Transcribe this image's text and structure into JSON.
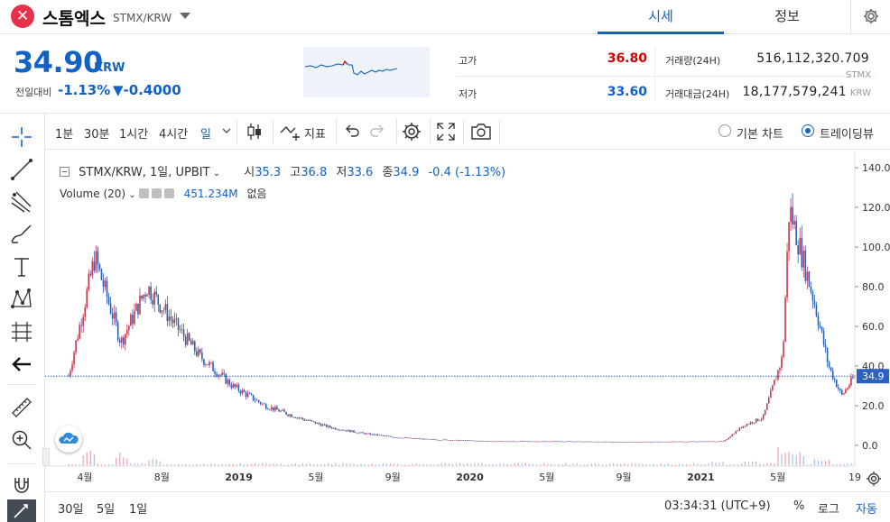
{
  "header": {
    "coin_name": "스톰엑스",
    "pair": "STMX/KRW",
    "tabs": [
      {
        "label": "시세",
        "active": true
      },
      {
        "label": "정보",
        "active": false
      }
    ]
  },
  "summary": {
    "price": "34.90",
    "price_unit": "KRW",
    "change_label": "전일대비",
    "change_rate": "-1.13%",
    "change_amount": "▼-0.4000",
    "high_label": "고가",
    "high_value": "36.80",
    "low_label": "저가",
    "low_value": "33.60",
    "volume_label": "거래량(24H)",
    "volume_value": "516,112,320.709",
    "volume_unit": "STMX",
    "amount_label": "거래대금(24H)",
    "amount_value": "18,177,579,241",
    "amount_unit": "KRW",
    "colors": {
      "up": "#d60000",
      "down": "#1261c4"
    }
  },
  "toolbar": {
    "intervals": [
      "1분",
      "30분",
      "1시간",
      "4시간",
      "일"
    ],
    "active_interval": "일",
    "indicators_label": "지표",
    "chart_types": [
      {
        "label": "기본 차트",
        "selected": false
      },
      {
        "label": "트레이딩뷰",
        "selected": true
      }
    ]
  },
  "chart": {
    "legend": {
      "symbol": "STMX/KRW, 1일, UPBIT",
      "open_key": "시",
      "open": "35.3",
      "high_key": "고",
      "high": "36.8",
      "low_key": "저",
      "low": "33.6",
      "close_key": "종",
      "close": "34.9",
      "change": "-0.4 (-1.13%)",
      "volume_label": "Volume (20)",
      "volume_value": "451.234M",
      "volume_extra": "없음"
    },
    "last_price_label": "34.9"
  },
  "chart_data": {
    "type": "line",
    "title": "",
    "xlabel": "",
    "ylabel": "",
    "x_ticks": [
      "4월",
      "8월",
      "2019",
      "5월",
      "9월",
      "2020",
      "5월",
      "9월",
      "2021",
      "5월",
      "19"
    ],
    "y_ticks": [
      "0.0",
      "20.0",
      "40.0",
      "60.0",
      "80.0",
      "100.0",
      "120.0",
      "140.0"
    ],
    "ylim": [
      -5,
      145
    ],
    "last_price": 34.9,
    "grid": false,
    "series": [
      {
        "x": [
          0,
          0.4,
          0.8,
          1.2,
          1.6,
          2.0,
          2.5,
          3.0,
          3.5,
          4.0,
          4.5,
          5.0,
          5.5,
          6.0,
          6.5,
          7.0,
          7.5,
          8.0,
          8.5,
          9.0,
          9.5,
          10.0,
          10.3,
          10.6,
          10.9,
          11.0,
          11.2,
          11.4,
          11.6,
          11.8,
          12.0
        ],
        "values": [
          35,
          95,
          52,
          80,
          62,
          45,
          30,
          20,
          14,
          9,
          6,
          4,
          3,
          2.5,
          2,
          2,
          2,
          1.8,
          1.7,
          1.8,
          1.9,
          2,
          10,
          14,
          45,
          120,
          95,
          70,
          40,
          25,
          34.9
        ]
      }
    ],
    "volume": {
      "x": [
        0.3,
        0.8,
        1.3,
        9.9,
        10.4,
        10.9,
        11.1,
        11.5
      ],
      "values": [
        18,
        14,
        9,
        5,
        6,
        22,
        16,
        9
      ]
    }
  },
  "bottom": {
    "ranges": [
      "30일",
      "5일",
      "1일"
    ],
    "time": "03:34:31 (UTC+9)",
    "percent": "%",
    "log": "로그",
    "auto": "자동"
  }
}
